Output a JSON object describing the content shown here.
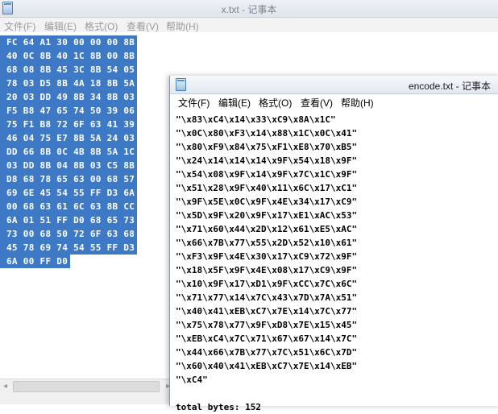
{
  "background_window": {
    "title": "x.txt - 记事本",
    "menu": [
      "文件(F)",
      "编辑(E)",
      "格式(O)",
      "查看(V)",
      "帮助(H)"
    ],
    "hex_lines": [
      "FC 64 A1 30 00 00 00 8B",
      "40 0C 8B 40 1C 8B 00 8B",
      "68 08 8B 45 3C 8B 54 05",
      "78 03 D5 8B 4A 18 8B 5A",
      "20 03 DD 49 8B 34 8B 03",
      "F5 B8 47 65 74 50 39 06",
      "75 F1 B8 72 6F 63 41 39",
      "46 04 75 E7 8B 5A 24 03",
      "DD 66 8B 0C 4B 8B 5A 1C",
      "03 DD 8B 04 8B 03 C5 8B",
      "D8 68 78 65 63 00 68 57",
      "69 6E 45 54 55 FF D3 6A",
      "00 68 63 61 6C 63 8B CC",
      "6A 01 51 FF D0 68 65 73",
      "73 00 68 50 72 6F 63 68",
      "45 78 69 74 54 55 FF D3",
      "6A 00 FF D0"
    ]
  },
  "foreground_window": {
    "title": "encode.txt - 记事本",
    "menu": [
      "文件(F)",
      "编辑(E)",
      "格式(O)",
      "查看(V)",
      "帮助(H)"
    ],
    "code_lines": [
      "\"\\x83\\xC4\\x14\\x33\\xC9\\x8A\\x1C\"",
      "\"\\x0C\\x80\\xF3\\x14\\x88\\x1C\\x0C\\x41\"",
      "\"\\x80\\xF9\\x84\\x75\\xF1\\xE8\\x70\\xB5\"",
      "\"\\x24\\x14\\x14\\x14\\x9F\\x54\\x18\\x9F\"",
      "\"\\x54\\x08\\x9F\\x14\\x9F\\x7C\\x1C\\x9F\"",
      "\"\\x51\\x28\\x9F\\x40\\x11\\x6C\\x17\\xC1\"",
      "\"\\x9F\\x5E\\x0C\\x9F\\x4E\\x34\\x17\\xC9\"",
      "\"\\x5D\\x9F\\x20\\x9F\\x17\\xE1\\xAC\\x53\"",
      "\"\\x71\\x60\\x44\\x2D\\x12\\x61\\xE5\\xAC\"",
      "\"\\x66\\x7B\\x77\\x55\\x2D\\x52\\x10\\x61\"",
      "\"\\xF3\\x9F\\x4E\\x30\\x17\\xC9\\x72\\x9F\"",
      "\"\\x18\\x5F\\x9F\\x4E\\x08\\x17\\xC9\\x9F\"",
      "\"\\x10\\x9F\\x17\\xD1\\x9F\\xCC\\x7C\\x6C\"",
      "\"\\x71\\x77\\x14\\x7C\\x43\\x7D\\x7A\\x51\"",
      "\"\\x40\\x41\\xEB\\xC7\\x7E\\x14\\x7C\\x77\"",
      "\"\\x75\\x78\\x77\\x9F\\xD8\\x7E\\x15\\x45\"",
      "\"\\xEB\\xC4\\x7C\\x71\\x67\\x67\\x14\\x7C\"",
      "\"\\x44\\x66\\x7B\\x77\\x7C\\x51\\x6C\\x7D\"",
      "\"\\x60\\x40\\x41\\xEB\\xC7\\x7E\\x14\\xEB\"",
      "\"\\xC4\""
    ],
    "total_line": "total bytes: 152"
  },
  "icons": {
    "app": "notepad-icon",
    "scroll_left": "◂",
    "scroll_right": "▸"
  },
  "colors": {
    "selection": "#3d79c4",
    "selection_text": "#ffffff"
  }
}
